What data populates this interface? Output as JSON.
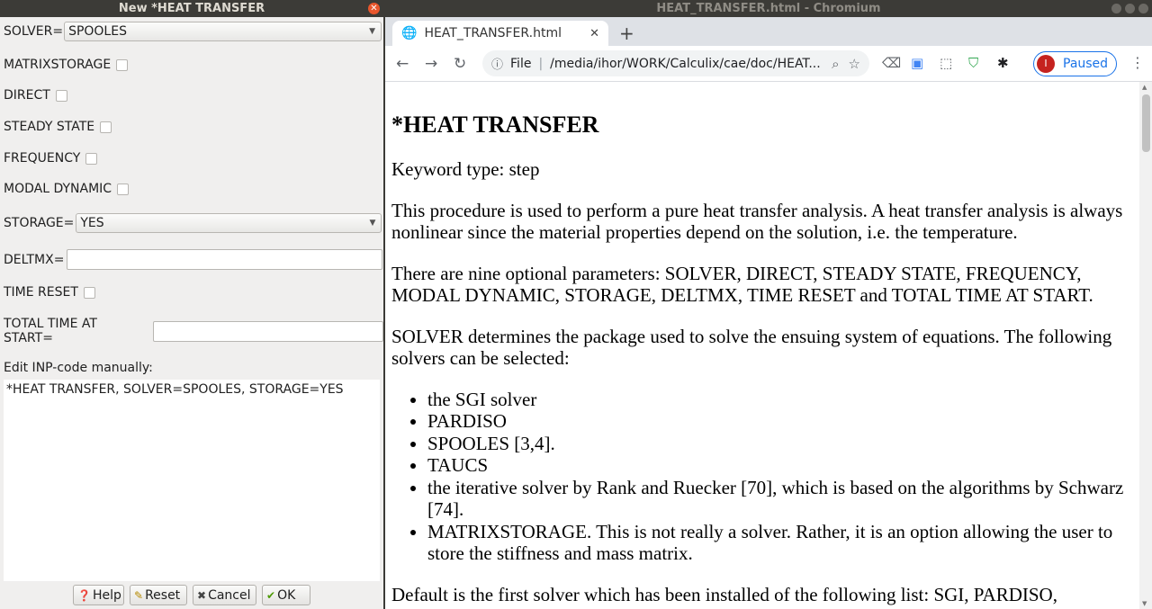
{
  "dialog": {
    "title": "New *HEAT TRANSFER",
    "solver_label": "SOLVER=",
    "solver_value": "SPOOLES",
    "matrixstorage_label": "MATRIXSTORAGE",
    "direct_label": "DIRECT",
    "steady_state_label": "STEADY STATE",
    "frequency_label": "FREQUENCY",
    "modal_dynamic_label": "MODAL DYNAMIC",
    "storage_label": "STORAGE=",
    "storage_value": "YES",
    "deltmx_label": "DELTMX=",
    "time_reset_label": "TIME RESET",
    "total_time_label": "TOTAL TIME AT START=",
    "edit_label": "Edit INP-code manually:",
    "inp_code": "*HEAT TRANSFER, SOLVER=SPOOLES, STORAGE=YES",
    "buttons": {
      "help": "Help",
      "reset": "Reset",
      "cancel": "Cancel",
      "ok": "OK"
    }
  },
  "browser": {
    "window_title": "HEAT_TRANSFER.html - Chromium",
    "tab_title": "HEAT_TRANSFER.html",
    "omnibox_scheme": "File",
    "omnibox_url": "/media/ihor/WORK/Calculix/cae/doc/HEAT...",
    "profile_initial": "I",
    "profile_label": "Paused"
  },
  "doc": {
    "heading": "*HEAT TRANSFER",
    "keyword_type": "Keyword type: step",
    "p1": "This procedure is used to perform a pure heat transfer analysis. A heat transfer analysis is always nonlinear since the material properties depend on the solution, i.e. the temperature.",
    "p2": "There are nine optional parameters: SOLVER, DIRECT, STEADY STATE, FREQUENCY, MODAL DYNAMIC, STORAGE, DELTMX, TIME RESET and TOTAL TIME AT START.",
    "p3": "SOLVER determines the package used to solve the ensuing system of equations. The following solvers can be selected:",
    "solvers": [
      "the SGI solver",
      "PARDISO",
      "SPOOLES [3,4].",
      "TAUCS",
      "the iterative solver by Rank and Ruecker [70], which is based on the algorithms by Schwarz [74].",
      "MATRIXSTORAGE. This is not really a solver. Rather, it is an option allowing the user to store the stiffness and mass matrix."
    ],
    "p4": "Default is the first solver which has been installed of the following list: SGI, PARDISO,"
  }
}
